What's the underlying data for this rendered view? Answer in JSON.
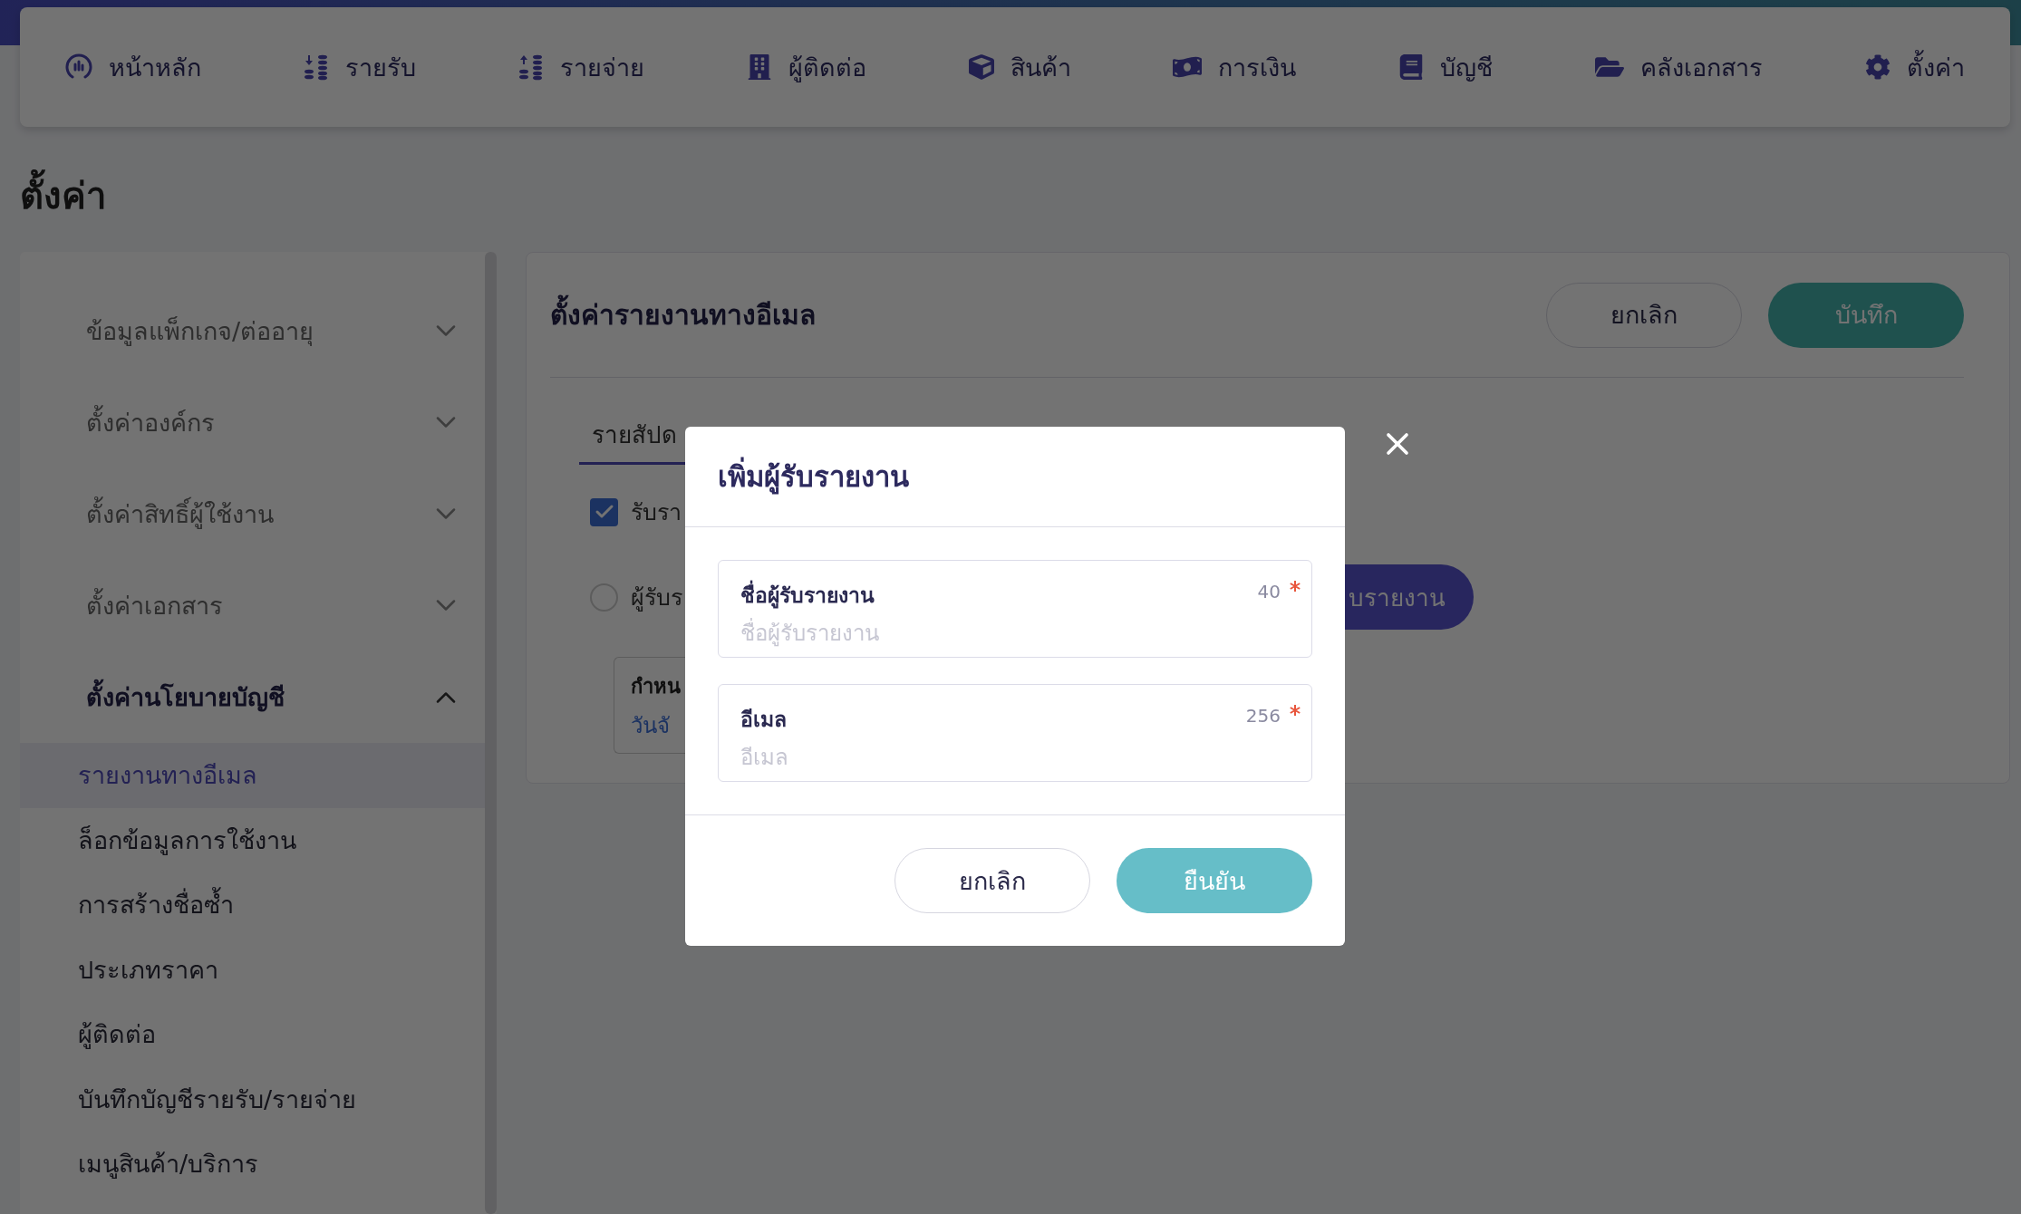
{
  "nav": [
    {
      "label": "หน้าหลัก"
    },
    {
      "label": "รายรับ"
    },
    {
      "label": "รายจ่าย"
    },
    {
      "label": "ผู้ติดต่อ"
    },
    {
      "label": "สินค้า"
    },
    {
      "label": "การเงิน"
    },
    {
      "label": "บัญชี"
    },
    {
      "label": "คลังเอกสาร"
    },
    {
      "label": "ตั้งค่า"
    }
  ],
  "page_title": "ตั้งค่า",
  "sidebar": {
    "groups": [
      {
        "label": "ข้อมูลแพ็กเกจ/ต่ออายุ",
        "expanded": false
      },
      {
        "label": "ตั้งค่าองค์กร",
        "expanded": false
      },
      {
        "label": "ตั้งค่าสิทธิ์ผู้ใช้งาน",
        "expanded": false
      },
      {
        "label": "ตั้งค่าเอกสาร",
        "expanded": false
      },
      {
        "label": "ตั้งค่านโยบายบัญชี",
        "expanded": true,
        "children": [
          {
            "label": "รายงานทางอีเมล",
            "selected": true
          },
          {
            "label": "ล็อกข้อมูลการใช้งาน",
            "selected": false
          },
          {
            "label": "การสร้างชื่อซ้ำ",
            "selected": false
          },
          {
            "label": "ประเภทราคา",
            "selected": false
          },
          {
            "label": "ผู้ติดต่อ",
            "selected": false
          },
          {
            "label": "บันทึกบัญชีรายรับ/รายจ่าย",
            "selected": false
          },
          {
            "label": "เมนูสินค้า/บริการ",
            "selected": false
          }
        ]
      }
    ]
  },
  "content": {
    "title": "ตั้งค่ารายงานทางอีเมล",
    "buttons": [
      {
        "label": "ยกเลิก",
        "kind": "outline"
      },
      {
        "label": "บันทึก",
        "kind": "primary"
      }
    ],
    "tab": {
      "label": "รายสัปด",
      "selected": true
    },
    "checkbox": {
      "label": "รับรา",
      "checked": true
    },
    "radio": {
      "label": "ผู้รับร",
      "selected": false
    },
    "add_button": {
      "label": "บรายงาน"
    },
    "schedule": {
      "label": "กำหน",
      "value": "วันจั"
    }
  },
  "modal": {
    "title": "เพิ่มผู้รับรายงาน",
    "fields": [
      {
        "label": "ชื่อผู้รับรายงาน",
        "counter": "40",
        "required": true,
        "placeholder": "ชื่อผู้รับรายงาน"
      },
      {
        "label": "อีเมล",
        "counter": "256",
        "required": true,
        "placeholder": "อีเมล"
      }
    ],
    "buttons": [
      {
        "label": "ยกเลิก",
        "kind": "outline"
      },
      {
        "label": "ยืนยัน",
        "kind": "primary"
      }
    ]
  }
}
